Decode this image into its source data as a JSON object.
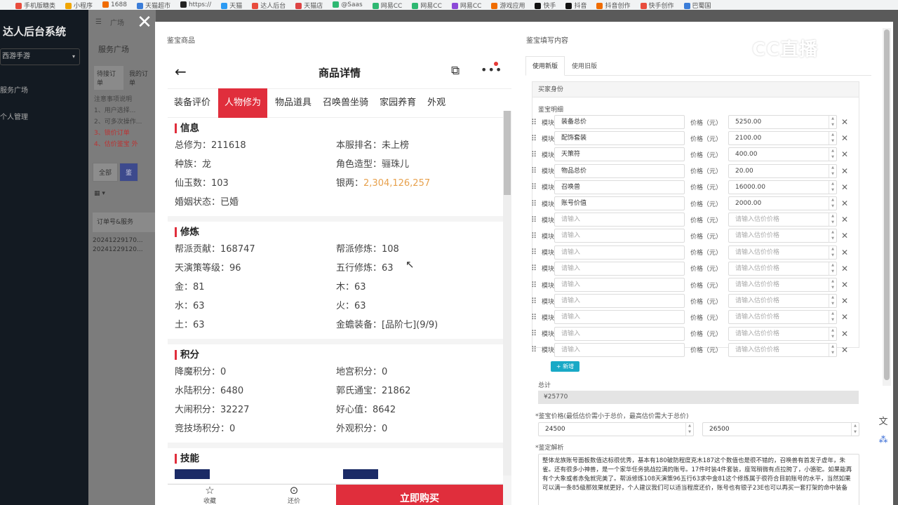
{
  "bookmarks": [
    "手机版糖类",
    "小程序",
    "1688",
    "天猫超市",
    "https://",
    "天猫",
    "达人后台",
    "天猫店",
    "@Saas",
    "网易CC",
    "网易CC",
    "网易CC",
    "游戏应用",
    "快手",
    "抖音",
    "抖音创作",
    "快手创作",
    "巴蜀国"
  ],
  "background": {
    "brand": "达人后台系统",
    "game_select": "西游手游",
    "menu": [
      "服务广场",
      "个人管理"
    ],
    "breadcrumb": [
      "广场",
      "服务广场"
    ],
    "page_title": "服务广场",
    "tabs": [
      "待接订单",
      "我的订单"
    ],
    "notice_title": "注意事项说明",
    "notices": [
      "1、用户选择...",
      "2、可多次操作...",
      "3、锁价订单",
      "4、估价鉴宝 外"
    ],
    "filter_buttons": [
      "全部",
      "鉴"
    ],
    "table_header": "订单号&服务",
    "order_rows": [
      "20241229170...",
      "20241229120..."
    ]
  },
  "dialog": {
    "close_icon": "close-icon",
    "left_label": "鉴宝商品",
    "right_label": "鉴宝填写内容"
  },
  "phone": {
    "title": "商品详情",
    "tabs": [
      "装备评价",
      "人物修为",
      "物品道具",
      "召唤兽坐骑",
      "家园养育",
      "外观"
    ],
    "active_tab": "人物修为",
    "sections": [
      {
        "title": "信息",
        "items": [
          "总修为：211618",
          "本服排名：未上榜",
          "种族：龙",
          "角色造型：骊珠儿",
          "仙玉数：103",
          "银两：2,304,126,257",
          "婚姻状态：已婚"
        ]
      },
      {
        "title": "修炼",
        "items": [
          "帮派贡献：168747",
          "帮派修炼：108",
          "天演策等级：96",
          "五行修炼：63",
          "金：81",
          "木：63",
          "水：63",
          "火：63",
          "土：63",
          "金蟾装备：[品阶七](9/9)"
        ]
      },
      {
        "title": "积分",
        "items": [
          "降魔积分：0",
          "地宫积分：0",
          "水陆积分：6480",
          "郭氏通宝：21862",
          "大闹积分：32227",
          "好心值：8642",
          "竞技场积分：0",
          "外观积分：0"
        ]
      },
      {
        "title": "技能",
        "items": []
      }
    ],
    "footer": {
      "favorite": "收藏",
      "bargain": "还价",
      "buy": "立即购买"
    }
  },
  "watermark": "CC直播",
  "form": {
    "tabs": [
      "使用新版",
      "使用旧版"
    ],
    "active_tab": "使用新版",
    "box_header": "买家身份",
    "detail_label": "鉴宝明细",
    "module_label": "模块",
    "price_label": "价格（元）",
    "name_placeholder": "请输入",
    "price_placeholder": "请输入估价价格",
    "rows": [
      {
        "name": "装备总价",
        "price": "5250.00"
      },
      {
        "name": "配饰套装",
        "price": "2100.00"
      },
      {
        "name": "天策符",
        "price": "400.00"
      },
      {
        "name": "物品总价",
        "price": "20.00"
      },
      {
        "name": "召唤兽",
        "price": "16000.00"
      },
      {
        "name": "账号价值",
        "price": "2000.00"
      },
      {
        "name": "",
        "price": ""
      },
      {
        "name": "",
        "price": ""
      },
      {
        "name": "",
        "price": ""
      },
      {
        "name": "",
        "price": ""
      },
      {
        "name": "",
        "price": ""
      },
      {
        "name": "",
        "price": ""
      },
      {
        "name": "",
        "price": ""
      },
      {
        "name": "",
        "price": ""
      },
      {
        "name": "",
        "price": ""
      }
    ],
    "add_button": "+ 新增",
    "total_label": "总计",
    "total_value": "¥25770",
    "price_range_label": "*鉴宝价格(最低估价需小于总价，最高估价需大于总价)",
    "price_min": "24500",
    "price_max": "26500",
    "analysis_label": "*鉴定解析",
    "analysis_text": "整体龙族账号面板数值达标很优秀，基本有180破防程度克木187这个数值也是很不错的，召唤兽有首发子虚年，朱雀。还有很多小神兽，是一个家华任务挑战拉满的账号。17件时装4件套装，座驾稍微有点拉胯了，小骆驼。如果能再有个大象或者赤兔就完美了。帮派修炼108天演策96五行63求中金81这个修炼属于很符合目前账号的水平，当然如果可以满一条85级那效果就更好，个人建议我们可以适当程度还价，账号也有银子23E也可以再买一套打架的命中装备"
  }
}
